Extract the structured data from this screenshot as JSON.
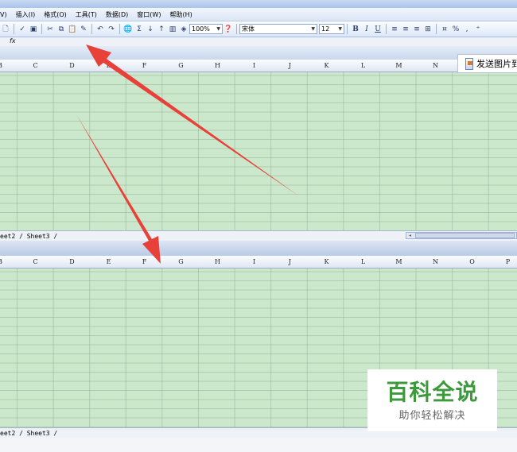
{
  "menu": [
    "V)",
    "插入(I)",
    "格式(O)",
    "工具(T)",
    "数据(D)",
    "窗口(W)",
    "帮助(H)"
  ],
  "toolbar": {
    "zoom": "100%",
    "font_name": "宋体",
    "font_size": "12",
    "bold": "B",
    "italic": "I",
    "underline": "U",
    "sum": "Σ",
    "percent": "%"
  },
  "formula_bar": {
    "fx": "fx"
  },
  "columns_top": [
    "B",
    "C",
    "D",
    "E",
    "F",
    "G",
    "H",
    "I",
    "J",
    "K",
    "L",
    "M",
    "N"
  ],
  "columns_bottom": [
    "B",
    "C",
    "D",
    "E",
    "F",
    "G",
    "H",
    "I",
    "J",
    "K",
    "L",
    "M",
    "N",
    "O",
    "P"
  ],
  "sheet_tabs": "eet2 / Sheet3 /",
  "task_pane": {
    "label": "发送图片到"
  },
  "watermark": {
    "title": "百科全说",
    "subtitle": "助你轻松解决"
  },
  "colors": {
    "sheet_bg": "#cce8cc",
    "arrow": "#e8413a",
    "watermark_green": "#3c9a3c"
  }
}
